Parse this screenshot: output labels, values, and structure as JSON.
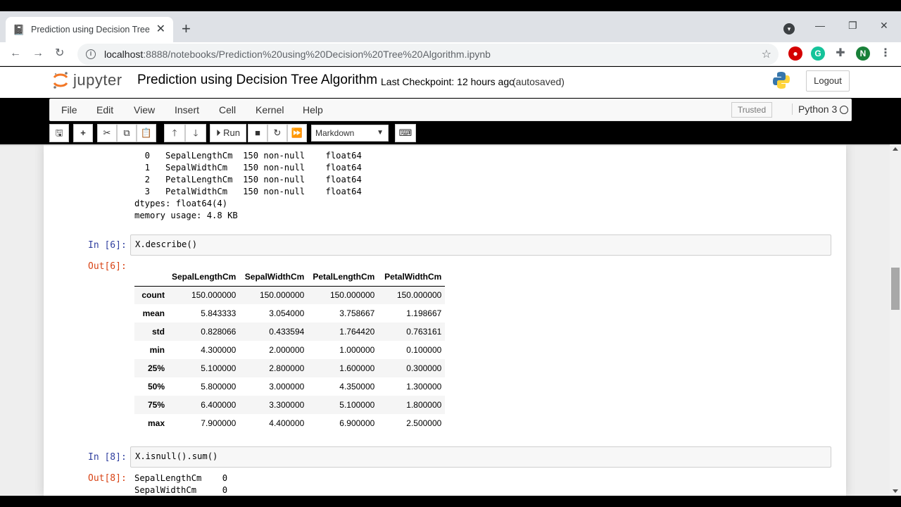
{
  "browser": {
    "tab_title": "Prediction using Decision Tree Al",
    "new_tab": "+",
    "close_tab": "✕",
    "url_host": "localhost",
    "url_path": ":8888/notebooks/Prediction%20using%20Decision%20Tree%20Algorithm.ipynb",
    "profile_initial": "N",
    "ext_grammarly": "G",
    "win_minimize": "—",
    "win_restore": "❐",
    "win_close": "✕"
  },
  "jupyter": {
    "logo_text": "jupyter",
    "notebook_title": "Prediction using Decision Tree Algorithm",
    "checkpoint": "Last Checkpoint: 12 hours ago",
    "autosave": "(autosaved)",
    "logout": "Logout",
    "menus": [
      "File",
      "Edit",
      "View",
      "Insert",
      "Cell",
      "Kernel",
      "Help"
    ],
    "trusted": "Trusted",
    "kernel": "Python 3",
    "run_label": "Run",
    "cell_type": "Markdown"
  },
  "output_top": {
    "dashes": " ---  ------         --------------  -----  ",
    "rows": [
      "  0   SepalLengthCm  150 non-null    float64",
      "  1   SepalWidthCm   150 non-null    float64",
      "  2   PetalLengthCm  150 non-null    float64",
      "  3   PetalWidthCm   150 non-null    float64"
    ],
    "dtypes": "dtypes: float64(4)",
    "memory": "memory usage: 4.8 KB"
  },
  "cell6": {
    "in_prompt": "In [6]:",
    "code": "X.describe()",
    "out_prompt": "Out[6]:",
    "columns": [
      "SepalLengthCm",
      "SepalWidthCm",
      "PetalLengthCm",
      "PetalWidthCm"
    ],
    "rows": [
      {
        "index": "count",
        "values": [
          "150.000000",
          "150.000000",
          "150.000000",
          "150.000000"
        ]
      },
      {
        "index": "mean",
        "values": [
          "5.843333",
          "3.054000",
          "3.758667",
          "1.198667"
        ]
      },
      {
        "index": "std",
        "values": [
          "0.828066",
          "0.433594",
          "1.764420",
          "0.763161"
        ]
      },
      {
        "index": "min",
        "values": [
          "4.300000",
          "2.000000",
          "1.000000",
          "0.100000"
        ]
      },
      {
        "index": "25%",
        "values": [
          "5.100000",
          "2.800000",
          "1.600000",
          "0.300000"
        ]
      },
      {
        "index": "50%",
        "values": [
          "5.800000",
          "3.000000",
          "4.350000",
          "1.300000"
        ]
      },
      {
        "index": "75%",
        "values": [
          "6.400000",
          "3.300000",
          "5.100000",
          "1.800000"
        ]
      },
      {
        "index": "max",
        "values": [
          "7.900000",
          "4.400000",
          "6.900000",
          "2.500000"
        ]
      }
    ]
  },
  "cell8": {
    "in_prompt": "In [8]:",
    "code": "X.isnull().sum()",
    "out_prompt": "Out[8]:",
    "lines": [
      "SepalLengthCm    0",
      "SepalWidthCm     0"
    ]
  }
}
